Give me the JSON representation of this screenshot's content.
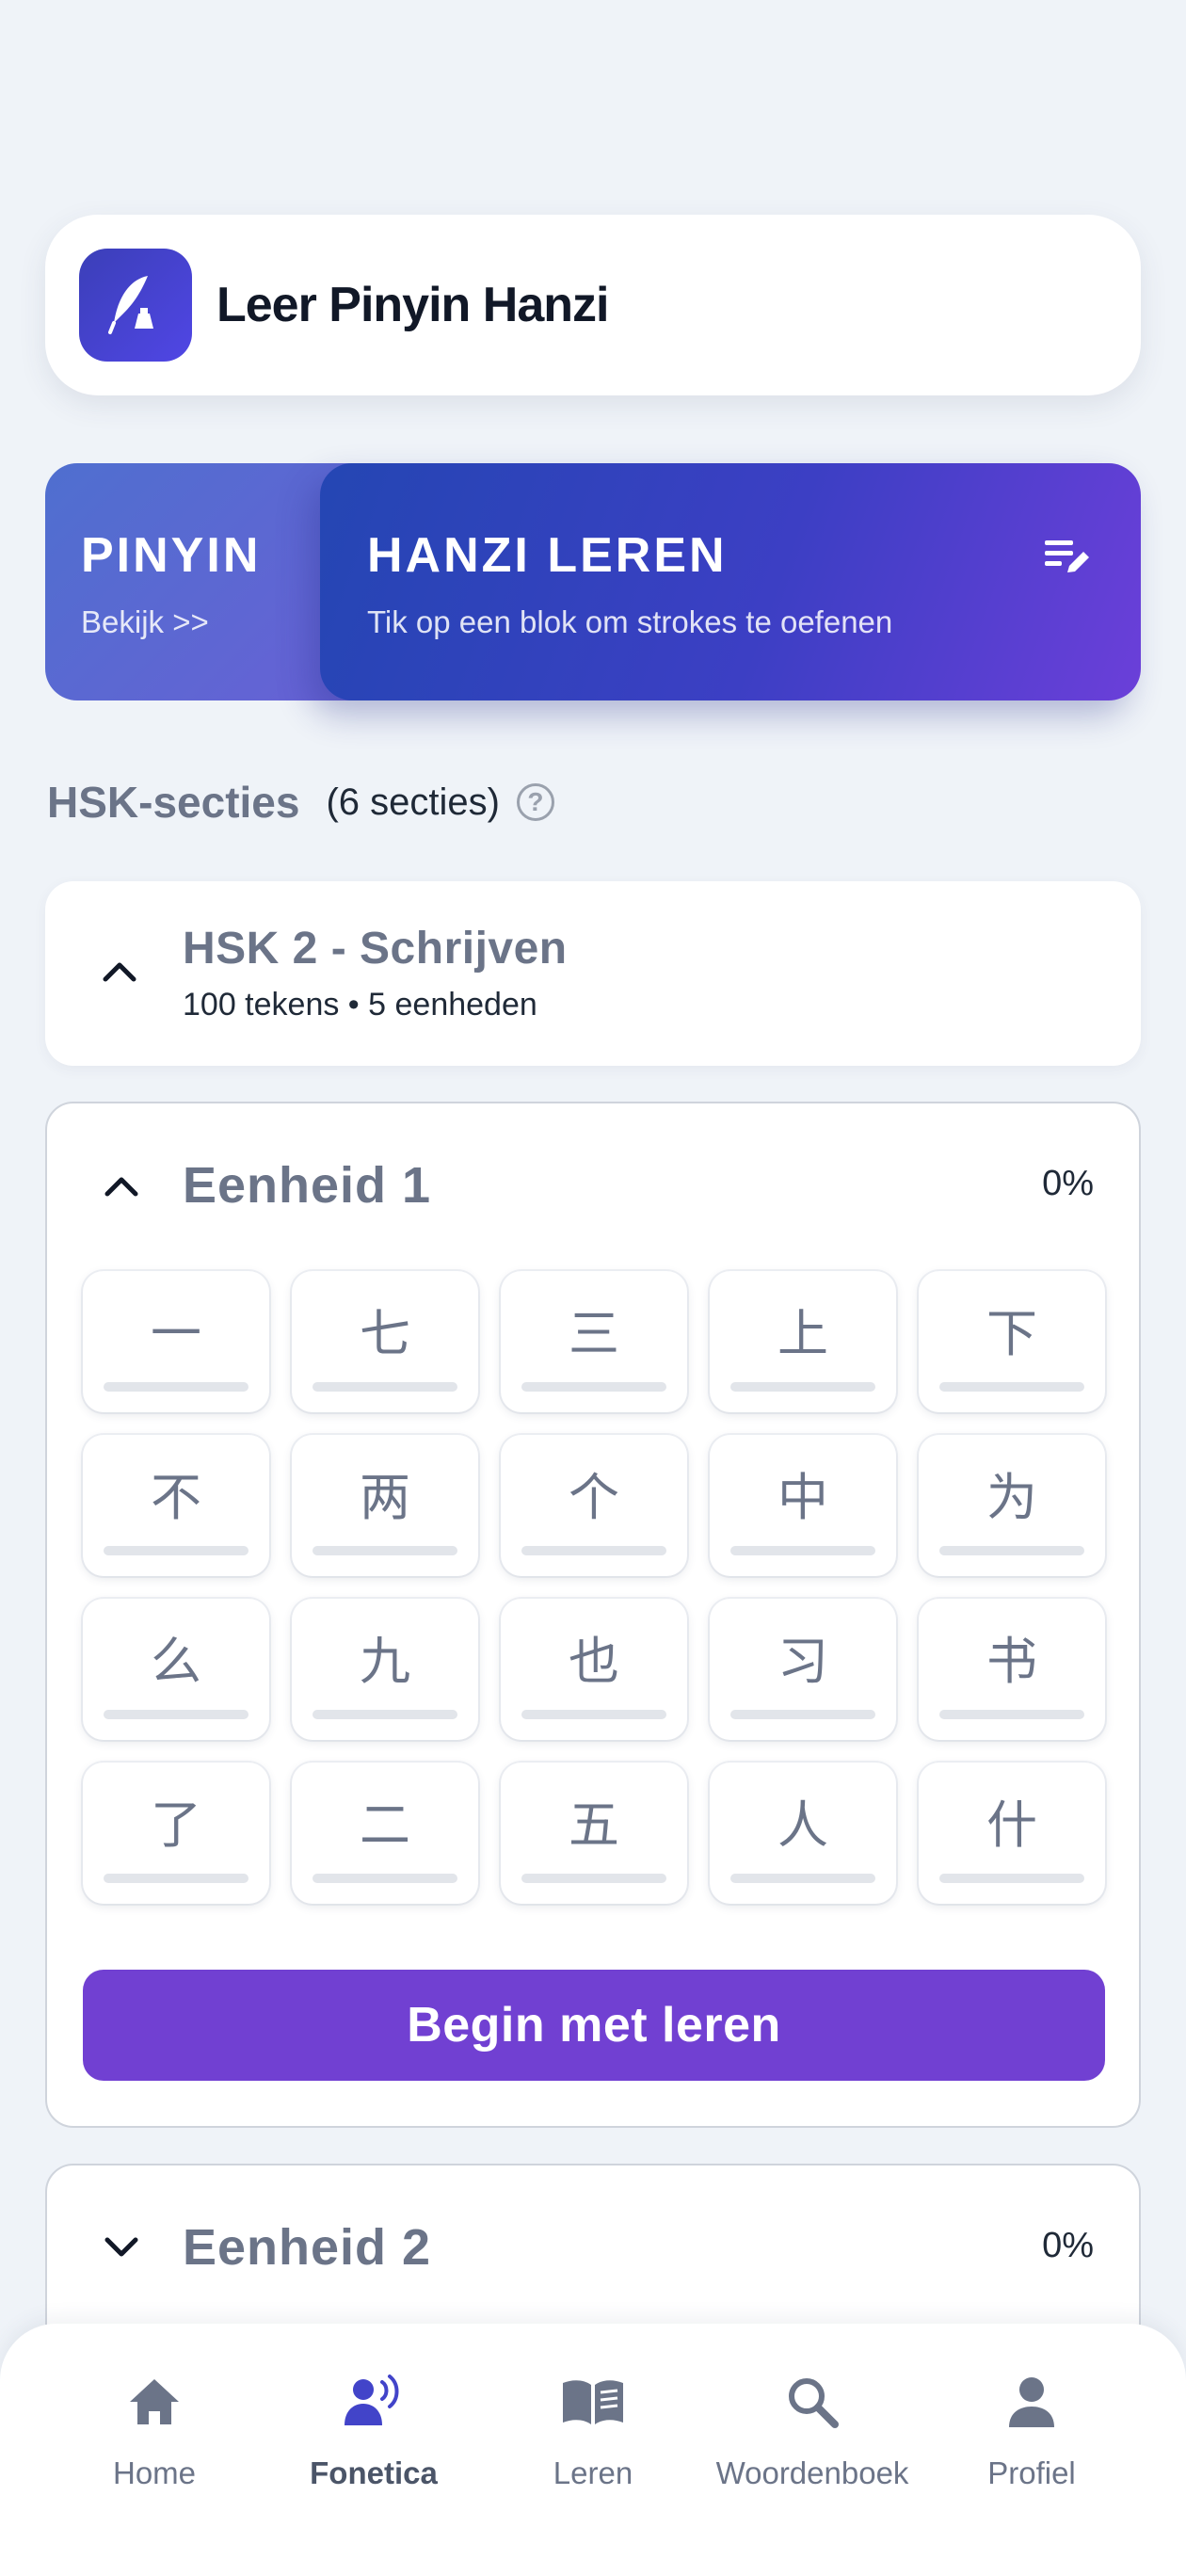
{
  "app": {
    "title": "Leer Pinyin Hanzi"
  },
  "modes": {
    "pinyin": {
      "title": "PINYIN",
      "subtitle": "Bekijk >>"
    },
    "hanzi": {
      "title": "HANZI LEREN",
      "subtitle": "Tik op een blok om strokes te oefenen"
    }
  },
  "sections": {
    "title": "HSK-secties",
    "count": "(6 secties)",
    "help_glyph": "?"
  },
  "hsk": {
    "title": "HSK 2 - Schrijven",
    "meta": "100 tekens • 5 eenheden"
  },
  "unit1": {
    "title": "Eenheid 1",
    "percent": "0%",
    "characters": [
      "一",
      "七",
      "三",
      "上",
      "下",
      "不",
      "两",
      "个",
      "中",
      "为",
      "么",
      "九",
      "也",
      "习",
      "书",
      "了",
      "二",
      "五",
      "人",
      "什"
    ],
    "button": "Begin met leren"
  },
  "unit2": {
    "title": "Eenheid 2",
    "percent": "0%"
  },
  "nav": {
    "items": [
      {
        "label": "Home",
        "icon": "home-icon"
      },
      {
        "label": "Fonetica",
        "icon": "speaker-person-icon",
        "active": true
      },
      {
        "label": "Leren",
        "icon": "book-icon"
      },
      {
        "label": "Woordenboek",
        "icon": "search-icon"
      },
      {
        "label": "Profiel",
        "icon": "person-icon"
      }
    ]
  },
  "colors": {
    "accent": "#7140d2",
    "brand": "#3b3fb8",
    "background": "#eff3f8"
  }
}
